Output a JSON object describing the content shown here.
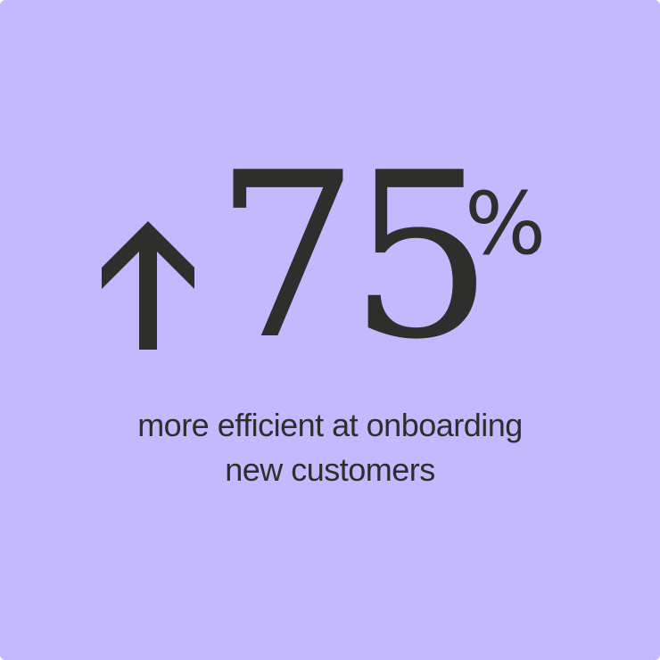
{
  "stat": {
    "direction_icon": "arrow-up-icon",
    "value": "75",
    "unit": "%",
    "caption_line1": "more efficient at onboarding",
    "caption_line2": "new customers"
  },
  "colors": {
    "background": "#c4b8fe",
    "text": "#2e2f2d"
  }
}
